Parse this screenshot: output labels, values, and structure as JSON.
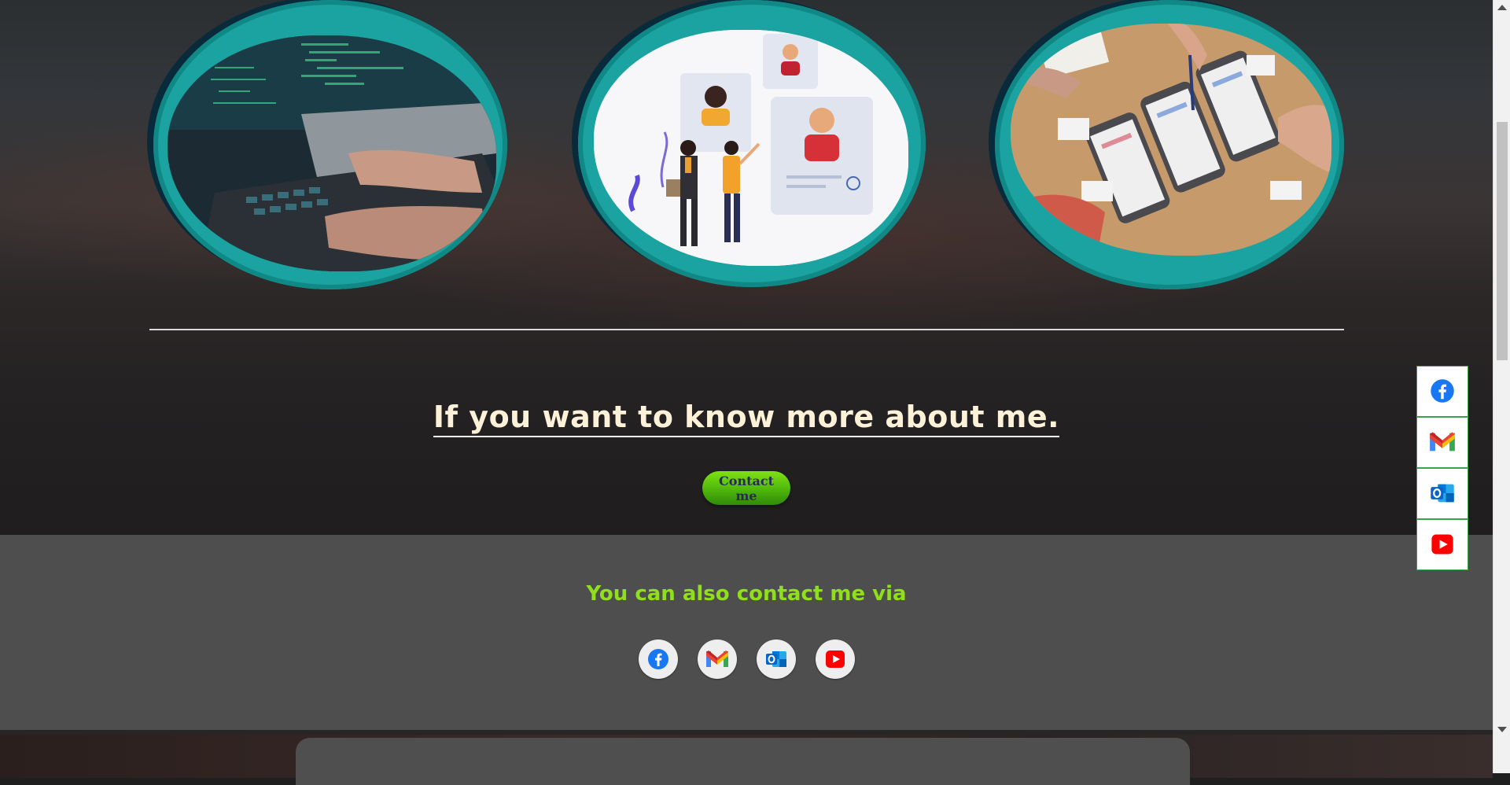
{
  "about": {
    "heading": "If you want to know more about me.",
    "contact_button_label": "Contact me"
  },
  "contact_section": {
    "title": "You can also contact me via",
    "icons": [
      "facebook-icon",
      "gmail-icon",
      "outlook-icon",
      "youtube-icon"
    ]
  },
  "side_social_bar": {
    "icons": [
      "facebook-icon",
      "gmail-icon",
      "outlook-icon",
      "youtube-icon"
    ]
  },
  "images": [
    {
      "name": "laptop-coding-image",
      "subject": "hands typing on a laptop keyboard with code on screen"
    },
    {
      "name": "recruitment-illustration-image",
      "subject": "illustration of people with candidate profile cards"
    },
    {
      "name": "app-wireframe-sketching-image",
      "subject": "hands sketching app wireframes on paper"
    }
  ],
  "colors": {
    "frame_teal": "#1aa3a0",
    "heading_cream": "#fdf2d8",
    "contact_title_green": "#8fe01a",
    "button_green": "#5cc410",
    "contact_bg": "#4e4e4e",
    "side_border": "#3aa24a",
    "facebook_blue": "#1877f2",
    "youtube_red": "#ff0000",
    "outlook_blue": "#0a64c8"
  }
}
